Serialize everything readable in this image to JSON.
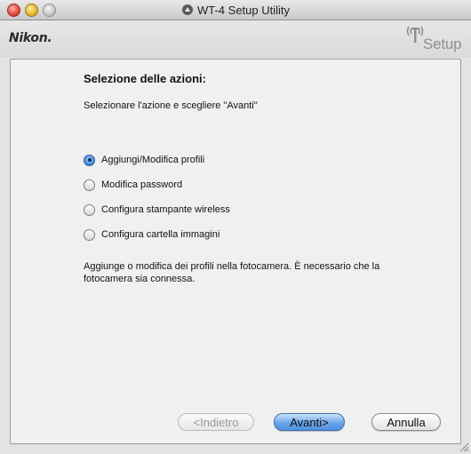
{
  "window": {
    "title": "WT-4 Setup Utility",
    "title_icon": "wireless-setup-icon"
  },
  "header": {
    "brand": "Nikon.",
    "setup_logo_text": "Setup",
    "setup_logo_icon": "antenna-icon"
  },
  "panel": {
    "heading": "Selezione delle azioni:",
    "instruction": "Selezionare l'azione e scegliere \"Avanti\"",
    "options": [
      {
        "label": "Aggiungi/Modifica profili",
        "selected": true
      },
      {
        "label": "Modifica password",
        "selected": false
      },
      {
        "label": "Configura stampante wireless",
        "selected": false
      },
      {
        "label": "Configura cartella immagini",
        "selected": false
      }
    ],
    "description": "Aggiunge o modifica dei profili nella fotocamera. È necessario che la fotocamera sia connessa."
  },
  "buttons": {
    "back": "<Indietro",
    "next": "Avanti>",
    "cancel": "Annulla"
  },
  "colors": {
    "accent": "#4f8fe0",
    "panel_bg": "#f0f0f0",
    "window_bg": "#e3e3e3"
  }
}
